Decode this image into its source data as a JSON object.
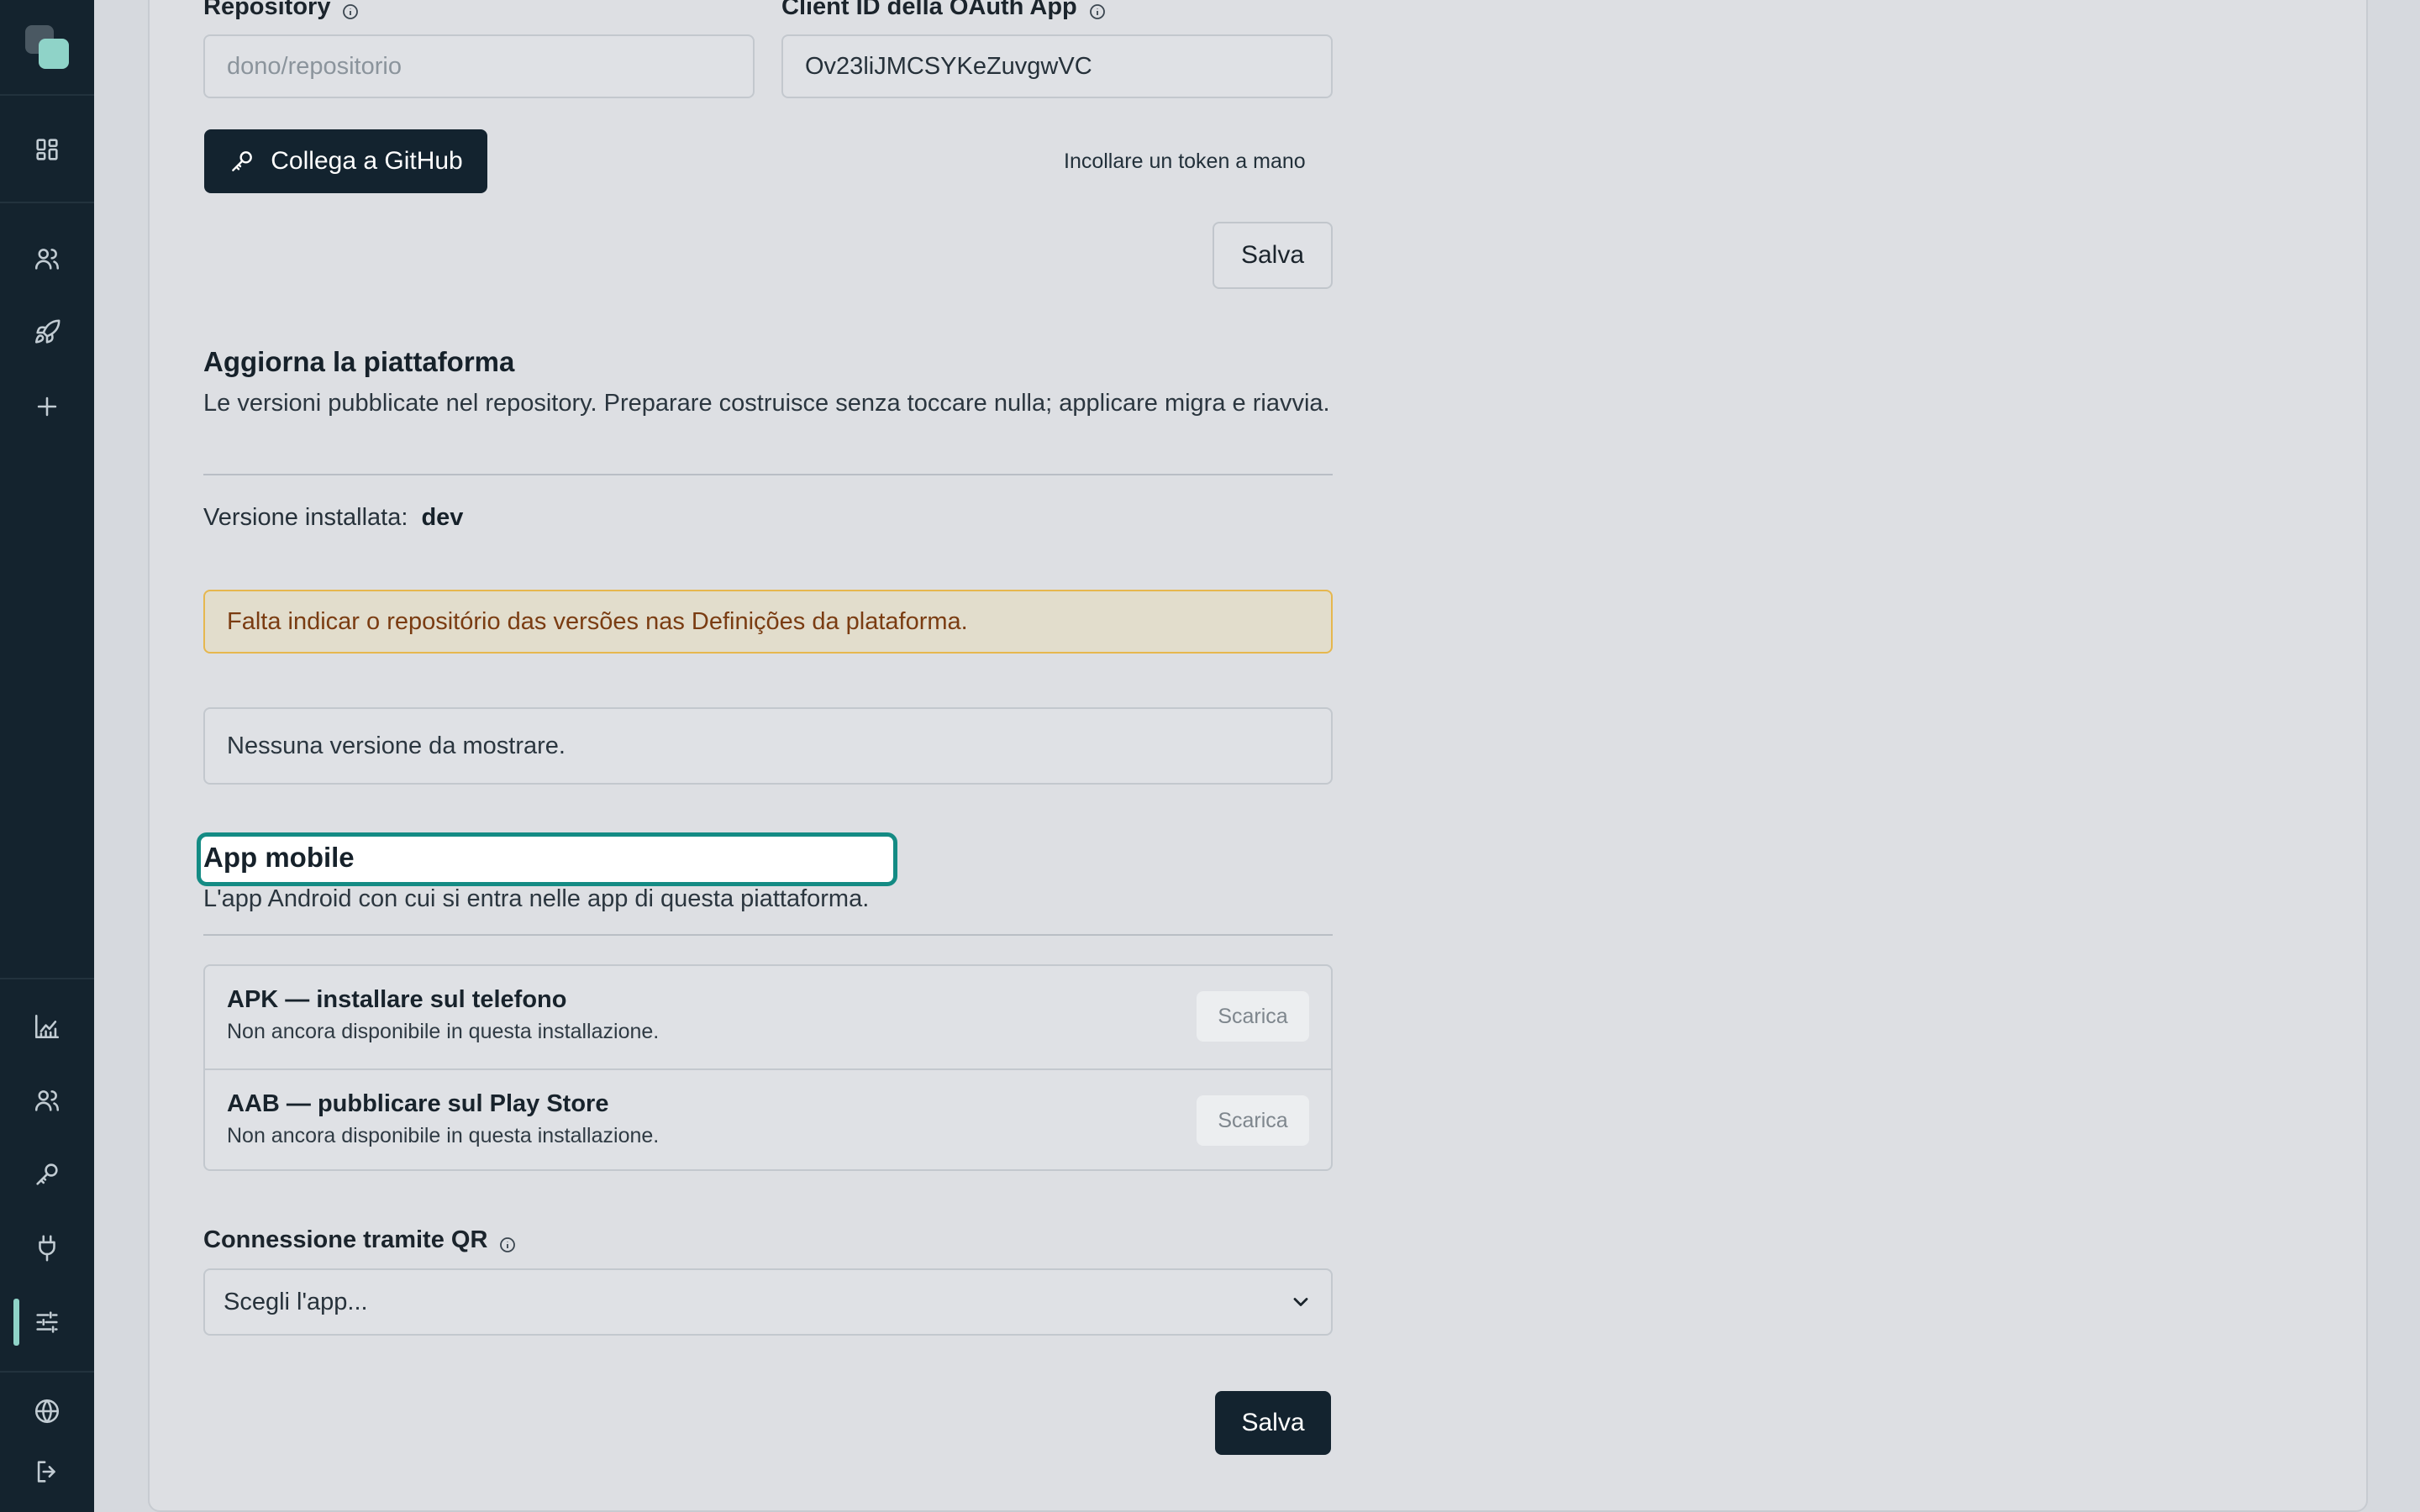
{
  "sidebar": {
    "top_items": [
      {
        "name": "dashboard-icon"
      },
      {
        "name": "users-icon"
      },
      {
        "name": "rocket-icon"
      },
      {
        "name": "plus-icon"
      }
    ],
    "bottom_items": [
      {
        "name": "analytics-icon"
      },
      {
        "name": "team-icon"
      },
      {
        "name": "key-icon"
      },
      {
        "name": "plug-icon"
      },
      {
        "name": "settings-sliders-icon",
        "active": true
      },
      {
        "name": "globe-icon"
      },
      {
        "name": "logout-icon"
      }
    ],
    "accent_color": "#8fd3c8"
  },
  "github": {
    "repository_label": "Repository",
    "repository_placeholder": "dono/repositorio",
    "client_id_label": "Client ID della OAuth App",
    "client_id_value": "Ov23liJMCSYKeZuvgwVC",
    "connect_button": "Collega a GitHub",
    "paste_token_link": "Incollare un token a mano",
    "save_button": "Salva"
  },
  "update": {
    "title": "Aggiorna la piattaforma",
    "description": "Le versioni pubblicate nel repository. Preparare costruisce senza toccare nulla; applicare migra e riavvia.",
    "installed_label": "Versione installata:",
    "installed_value": "dev",
    "warning": "Falta indicar o repositório das versões nas Definições da plataforma.",
    "empty_versions": "Nessuna versione da mostrare."
  },
  "mobile": {
    "title": "App mobile",
    "description": "L'app Android con cui si entra nelle app di questa piattaforma.",
    "items": [
      {
        "title": "APK — installare sul telefono",
        "subtitle": "Non ancora disponibile in questa installazione.",
        "button": "Scarica"
      },
      {
        "title": "AAB — pubblicare sul Play Store",
        "subtitle": "Non ancora disponibile in questa installazione.",
        "button": "Scarica"
      }
    ],
    "qr_label": "Connessione tramite QR",
    "qr_select_value": "Scegli l'app...",
    "save_button": "Salva"
  },
  "colors": {
    "primary_dark": "#13232f",
    "focus_ring": "#148b84",
    "warning_border": "#e6b74e",
    "warning_text": "#7a3c12"
  }
}
